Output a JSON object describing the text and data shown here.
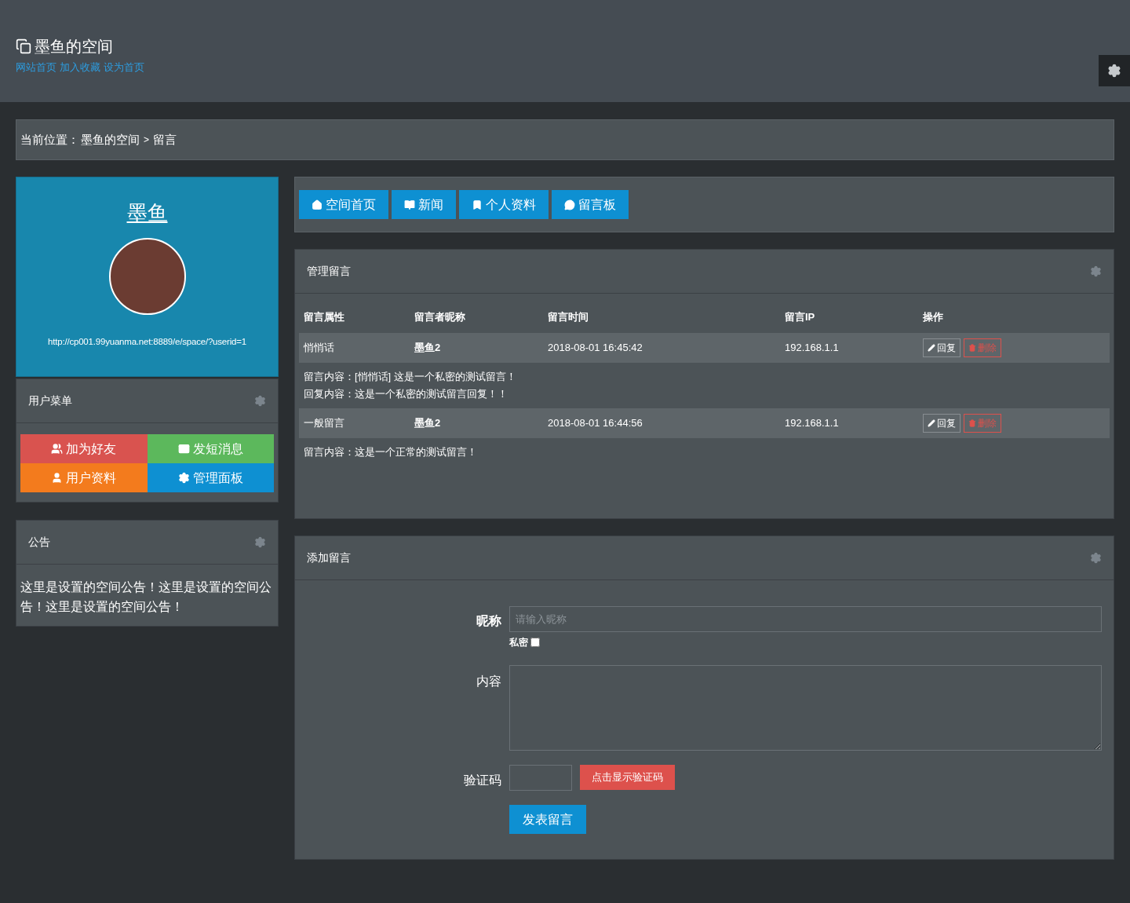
{
  "header": {
    "title": "墨鱼的空间",
    "links": [
      "网站首页",
      "加入收藏",
      "设为首页"
    ]
  },
  "breadcrumb": {
    "label": "当前位置：",
    "path": [
      "墨鱼的空间",
      "留言"
    ],
    "separator": ">"
  },
  "profile": {
    "name": "墨鱼",
    "url": "http://cp001.99yuanma.net:8889/e/space/?userid=1"
  },
  "user_menu": {
    "title": "用户菜单",
    "items": [
      {
        "label": "加为好友",
        "color": "#d9534f"
      },
      {
        "label": "发短消息",
        "color": "#5cb85c"
      },
      {
        "label": "用户资料",
        "color": "#f37b1d"
      },
      {
        "label": "管理面板",
        "color": "#0e90d2"
      }
    ]
  },
  "notice": {
    "title": "公告",
    "text": "这里是设置的空间公告！这里是设置的空间公告！这里是设置的空间公告！"
  },
  "nav": [
    {
      "label": "空间首页"
    },
    {
      "label": "新闻"
    },
    {
      "label": "个人资料"
    },
    {
      "label": "留言板"
    }
  ],
  "manage": {
    "title": "管理留言",
    "columns": [
      "留言属性",
      "留言者昵称",
      "留言时间",
      "留言IP",
      "操作"
    ],
    "messages": [
      {
        "cells": [
          "悄悄话",
          "墨鱼2",
          "2018-08-01 16:45:42",
          "192.168.1.1"
        ],
        "actions": [
          "回复",
          "删除"
        ],
        "lines": [
          "留言内容：[悄悄话] 这是一个私密的测试留言！",
          "回复内容：这是一个私密的测试留言回复！！"
        ]
      },
      {
        "cells": [
          "一般留言",
          "墨鱼2",
          "2018-08-01 16:44:56",
          "192.168.1.1"
        ],
        "actions": [
          "回复",
          "删除"
        ],
        "lines": [
          "留言内容：这是一个正常的测试留言！"
        ]
      }
    ]
  },
  "add": {
    "title": "添加留言",
    "nickname_label": "昵称",
    "nickname_placeholder": "请输入昵称",
    "private_label": "私密",
    "private_checked": false,
    "content_label": "内容",
    "captcha_label": "验证码",
    "captcha_button": "点击显示验证码",
    "submit": "发表留言"
  }
}
